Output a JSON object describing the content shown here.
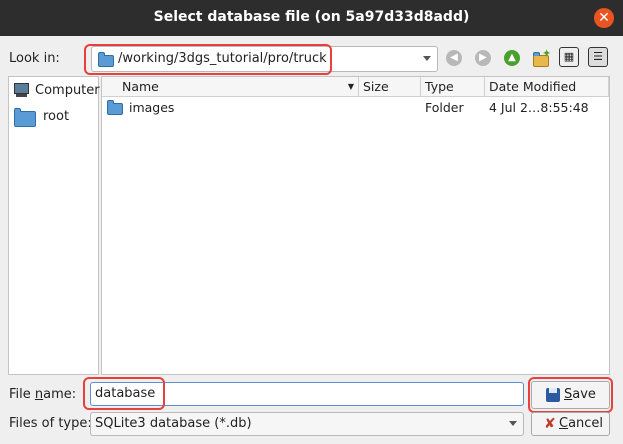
{
  "window": {
    "title": "Select database file (on 5a97d33d8add)"
  },
  "look_in": {
    "label": "Look in:",
    "path": "/working/3dgs_tutorial/pro/truck"
  },
  "sidebar": {
    "items": [
      {
        "label": "Computer",
        "icon": "computer-icon"
      },
      {
        "label": "root",
        "icon": "folder-icon"
      }
    ]
  },
  "files": {
    "columns": [
      "Name",
      "Size",
      "Type",
      "Date Modified"
    ],
    "rows": [
      {
        "name": "images",
        "size": "",
        "type": "Folder",
        "date": "4 Jul 2…8:55:48"
      }
    ]
  },
  "file_name": {
    "label_pre": "File ",
    "label_ul": "n",
    "label_post": "ame:",
    "value": "database"
  },
  "files_of_type": {
    "label": "Files of type:",
    "value": "SQLite3 database (*.db)"
  },
  "buttons": {
    "save_ul": "S",
    "save_rest": "ave",
    "cancel_ul": "C",
    "cancel_rest": "ancel"
  }
}
